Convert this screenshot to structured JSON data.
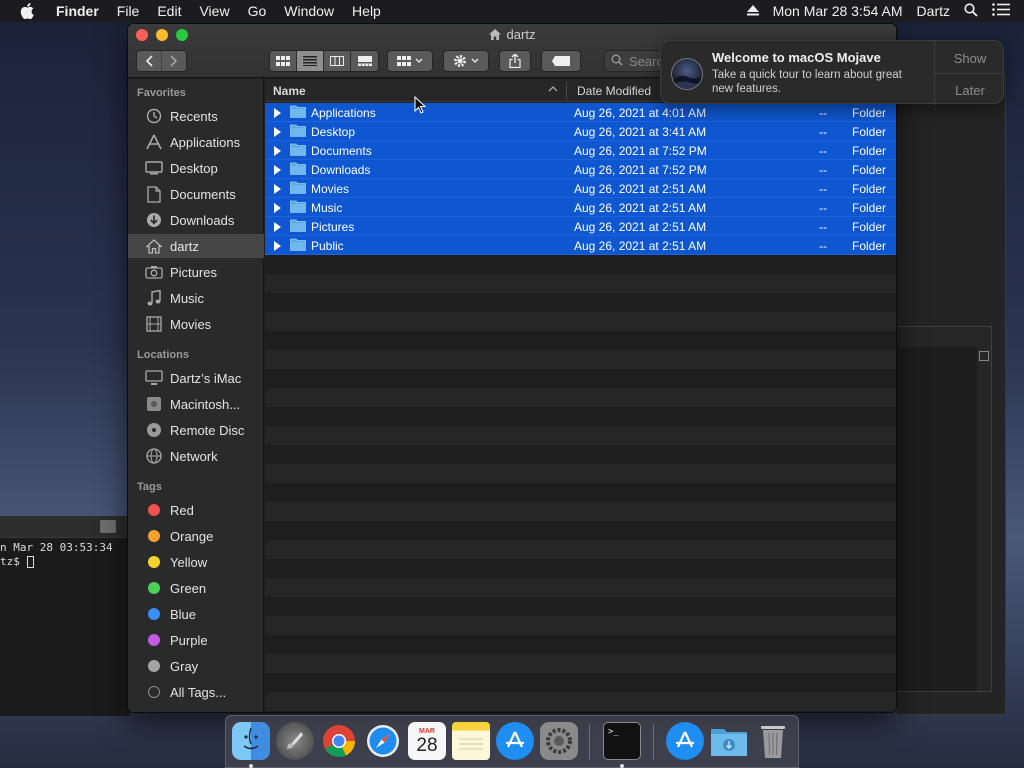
{
  "menubar": {
    "app_name": "Finder",
    "items": [
      "File",
      "Edit",
      "View",
      "Go",
      "Window",
      "Help"
    ],
    "datetime": "Mon Mar 28  3:54 AM",
    "user": "Dartz"
  },
  "terminal": {
    "line1": "n Mar 28 03:53:34",
    "line2": "tz$ "
  },
  "window": {
    "title": "dartz",
    "search_placeholder": "Searc"
  },
  "sidebar": {
    "favorites_header": "Favorites",
    "favorites": [
      {
        "label": "Recents",
        "icon": "clock-icon"
      },
      {
        "label": "Applications",
        "icon": "applications-icon"
      },
      {
        "label": "Desktop",
        "icon": "desktop-icon"
      },
      {
        "label": "Documents",
        "icon": "document-icon"
      },
      {
        "label": "Downloads",
        "icon": "download-icon"
      },
      {
        "label": "dartz",
        "icon": "home-icon"
      },
      {
        "label": "Pictures",
        "icon": "camera-icon"
      },
      {
        "label": "Music",
        "icon": "music-note-icon"
      },
      {
        "label": "Movies",
        "icon": "film-icon"
      }
    ],
    "locations_header": "Locations",
    "locations": [
      {
        "label": "Dartz’s iMac",
        "icon": "computer-icon"
      },
      {
        "label": "Macintosh...",
        "icon": "hard-drive-icon"
      },
      {
        "label": "Remote Disc",
        "icon": "disc-icon"
      },
      {
        "label": "Network",
        "icon": "globe-icon"
      }
    ],
    "tags_header": "Tags",
    "tags": [
      {
        "label": "Red",
        "color": "#f0534e"
      },
      {
        "label": "Orange",
        "color": "#f4a22d"
      },
      {
        "label": "Yellow",
        "color": "#f6d32c"
      },
      {
        "label": "Green",
        "color": "#4cd05a"
      },
      {
        "label": "Blue",
        "color": "#3a8ff7"
      },
      {
        "label": "Purple",
        "color": "#c05ce2"
      },
      {
        "label": "Gray",
        "color": "#a3a3a3"
      },
      {
        "label": "All Tags...",
        "color": "#555555"
      }
    ]
  },
  "columns": {
    "name": "Name",
    "date_modified": "Date Modified"
  },
  "files": [
    {
      "name": "Applications",
      "date": "Aug 26, 2021 at 4:01 AM",
      "size": "--",
      "kind": "Folder"
    },
    {
      "name": "Desktop",
      "date": "Aug 26, 2021 at 3:41 AM",
      "size": "--",
      "kind": "Folder"
    },
    {
      "name": "Documents",
      "date": "Aug 26, 2021 at 7:52 PM",
      "size": "--",
      "kind": "Folder"
    },
    {
      "name": "Downloads",
      "date": "Aug 26, 2021 at 7:52 PM",
      "size": "--",
      "kind": "Folder"
    },
    {
      "name": "Movies",
      "date": "Aug 26, 2021 at 2:51 AM",
      "size": "--",
      "kind": "Folder"
    },
    {
      "name": "Music",
      "date": "Aug 26, 2021 at 2:51 AM",
      "size": "--",
      "kind": "Folder"
    },
    {
      "name": "Pictures",
      "date": "Aug 26, 2021 at 2:51 AM",
      "size": "--",
      "kind": "Folder"
    },
    {
      "name": "Public",
      "date": "Aug 26, 2021 at 2:51 AM",
      "size": "--",
      "kind": "Folder"
    }
  ],
  "notification": {
    "title": "Welcome to macOS Mojave",
    "body": "Take a quick tour to learn about great new features.",
    "show_label": "Show",
    "later_label": "Later"
  },
  "dock": {
    "items": [
      "finder-icon",
      "launchpad-icon",
      "chrome-icon",
      "safari-icon",
      "calendar-icon",
      "notes-icon",
      "app-store-icon",
      "system-preferences-icon",
      "terminal-icon",
      "applications-folder-icon",
      "downloads-folder-icon",
      "trash-icon"
    ],
    "calendar_month": "MAR",
    "calendar_day": "28"
  }
}
